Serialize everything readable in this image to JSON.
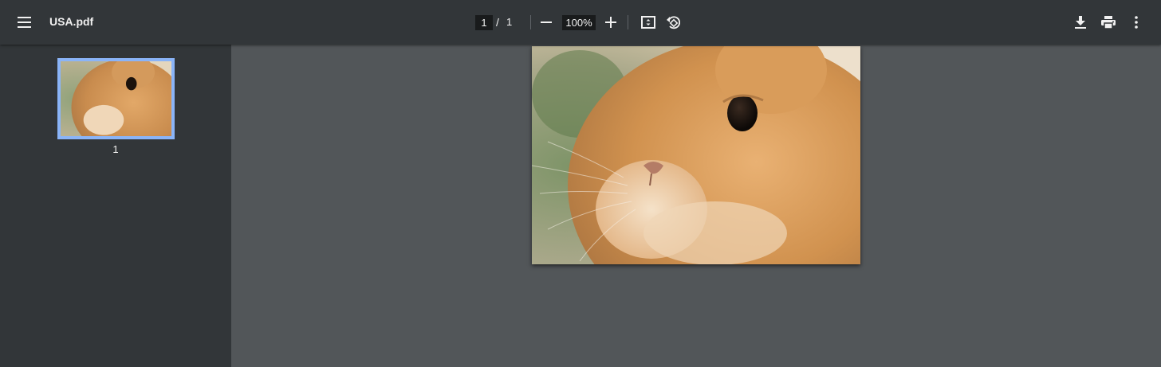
{
  "toolbar": {
    "menu_icon": "hamburger-menu-icon",
    "title": "USA.pdf",
    "page_current": "1",
    "page_separator": "/",
    "page_total": "1",
    "zoom_out_icon": "minus-icon",
    "zoom_value": "100%",
    "zoom_in_icon": "plus-icon",
    "fit_icon": "fit-to-page-icon",
    "rotate_icon": "rotate-counterclockwise-icon",
    "download_icon": "download-icon",
    "print_icon": "print-icon",
    "more_icon": "more-vertical-icon"
  },
  "sidebar": {
    "thumbnails": [
      {
        "page_label": "1"
      }
    ],
    "selected_border_color": "#8ab4f8"
  },
  "document": {
    "image_subject": "close-up photo of an orange rabbit"
  },
  "colors": {
    "toolbar_bg": "#323639",
    "viewer_bg": "#525659",
    "text": "#f1f1f1"
  }
}
